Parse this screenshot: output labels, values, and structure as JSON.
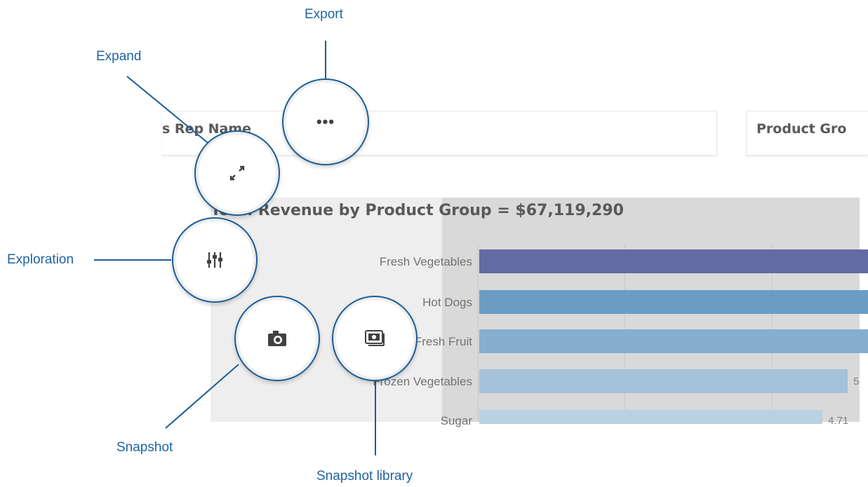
{
  "filters": {
    "sales_rep": "s Rep Name",
    "product_group": "Product Gro"
  },
  "chart": {
    "title": "Total Revenue by Product Group = $67,119,290"
  },
  "chart_data": {
    "type": "bar",
    "orientation": "horizontal",
    "title": "Total Revenue by Product Group = $67,119,290",
    "categories": [
      "Fresh Vegetables",
      "Hot Dogs",
      "Fresh Fruit",
      "Frozen Vegetables",
      "Sugar"
    ],
    "value_labels": [
      "",
      "",
      "",
      "5",
      "4.71"
    ],
    "colors": [
      "#626ca3",
      "#6b9dc4",
      "#86aecf",
      "#a4c2da",
      "#b8d1e3"
    ],
    "grid": true
  },
  "callouts": {
    "export": "Export",
    "expand": "Expand",
    "exploration": "Exploration",
    "snapshot": "Snapshot",
    "snapshot_library": "Snapshot library"
  },
  "icons": {
    "export": "more-dots-icon",
    "expand": "expand-arrows-icon",
    "exploration": "sliders-icon",
    "snapshot": "camera-icon",
    "snapshot_library": "snapshot-library-icon"
  },
  "accent_color": "#1b5d96"
}
